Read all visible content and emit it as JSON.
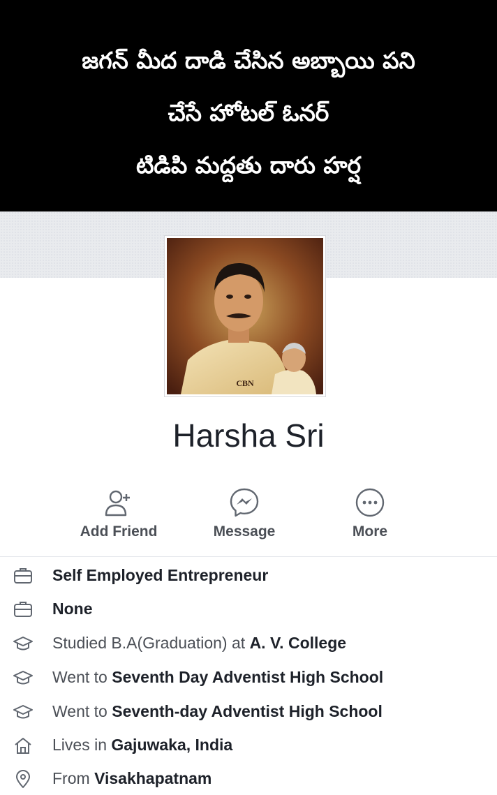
{
  "banner": {
    "line1": "జగన్ మీద దాడి చేసిన అబ్బాయి పని",
    "line2": "చేసే హోటల్ ఓనర్",
    "line3": "టిడిపి మద్దతు దారు హర్ష"
  },
  "profile": {
    "name": "Harsha Sri",
    "photo_caption": "CBN"
  },
  "actions": {
    "add_friend": "Add Friend",
    "message": "Message",
    "more": "More"
  },
  "about": [
    {
      "icon": "briefcase-icon",
      "prefix": "",
      "bold": "Self Employed Entrepreneur"
    },
    {
      "icon": "briefcase-icon",
      "prefix": "",
      "bold": "None"
    },
    {
      "icon": "graduation-cap-icon",
      "prefix": "Studied B.A(Graduation) at ",
      "bold": "A. V. College"
    },
    {
      "icon": "graduation-cap-icon",
      "prefix": "Went to ",
      "bold": "Seventh Day Adventist High School"
    },
    {
      "icon": "graduation-cap-icon",
      "prefix": "Went to ",
      "bold": "Seventh-day Adventist High School"
    },
    {
      "icon": "home-icon",
      "prefix": "Lives in ",
      "bold": "Gajuwaka, India"
    },
    {
      "icon": "location-pin-icon",
      "prefix": "From ",
      "bold": "Visakhapatnam"
    }
  ],
  "colors": {
    "banner_bg": "#000000",
    "banner_text": "#ffffff",
    "cover_bg": "#e9ebee",
    "icon_gray": "#616770",
    "text_dark": "#1d2129"
  }
}
